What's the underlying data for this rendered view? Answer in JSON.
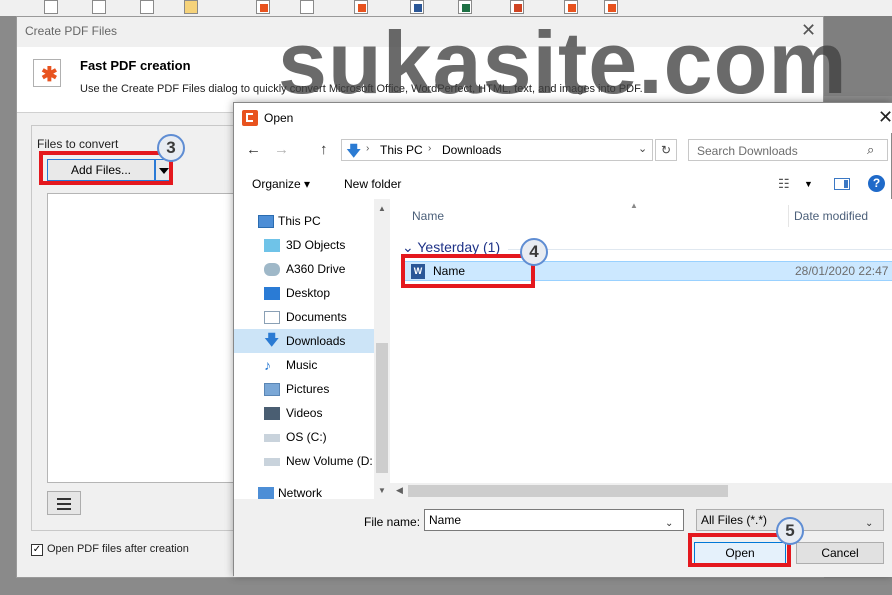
{
  "create_dialog": {
    "title": "Create PDF Files",
    "close": "✕",
    "header_title": "Fast PDF creation",
    "header_desc": "Use the Create PDF Files dialog to quickly convert Microsoft Office, WordPerfect, HTML, text, and images into PDF.",
    "files_label": "Files to convert",
    "add_files_label": "Add Files...",
    "open_after_label": "Open PDF files after creation",
    "open_after_checked": true
  },
  "open_dialog": {
    "title": "Open",
    "close": "✕",
    "address": {
      "root": "This PC",
      "folder": "Downloads",
      "separator": "›"
    },
    "search_placeholder": "Search Downloads",
    "toolbar": {
      "organize": "Organize ▾",
      "new_folder": "New folder"
    },
    "nav_items": [
      {
        "label": "This PC",
        "icon": "computer-icon"
      },
      {
        "label": "3D Objects",
        "icon": "cube-icon"
      },
      {
        "label": "A360 Drive",
        "icon": "cloud-drive-icon"
      },
      {
        "label": "Desktop",
        "icon": "desktop-icon"
      },
      {
        "label": "Documents",
        "icon": "documents-icon"
      },
      {
        "label": "Downloads",
        "icon": "download-arrow-icon"
      },
      {
        "label": "Music",
        "icon": "music-note-icon"
      },
      {
        "label": "Pictures",
        "icon": "pictures-icon"
      },
      {
        "label": "Videos",
        "icon": "videos-icon"
      },
      {
        "label": "OS (C:)",
        "icon": "drive-icon"
      },
      {
        "label": "New Volume (D:",
        "icon": "drive-icon"
      },
      {
        "label": "Network",
        "icon": "network-icon"
      }
    ],
    "selected_nav": "Downloads",
    "columns": {
      "name": "Name",
      "date": "Date modified"
    },
    "group_header": "Yesterday (1)",
    "files": [
      {
        "name": "Name",
        "date": "28/01/2020 22:47",
        "icon": "word-doc-icon"
      }
    ],
    "file_name_label": "File name:",
    "file_name_value": "Name",
    "file_type": "All Files (*.*)",
    "open_button": "Open",
    "cancel_button": "Cancel"
  },
  "annotations": {
    "step3": "3",
    "step4": "4",
    "step5": "5",
    "highlight_color": "#e4181e"
  },
  "watermark": "sukasite.com",
  "colors": {
    "selection": "#cce8ff",
    "accent": "#0078d7",
    "group_header": "#1e3287"
  }
}
